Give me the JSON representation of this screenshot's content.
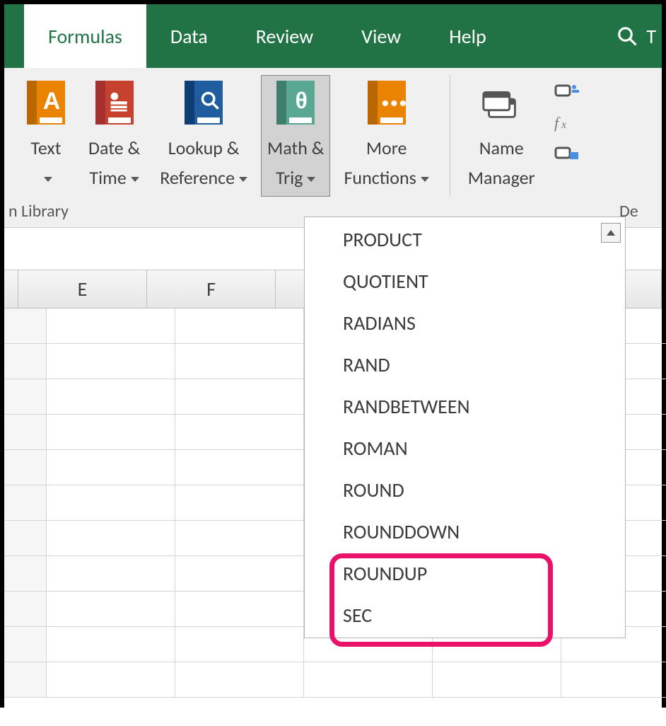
{
  "tabs": {
    "formulas": "Formulas",
    "data": "Data",
    "review": "Review",
    "view": "View",
    "help": "Help",
    "tellme": "T"
  },
  "ribbon": {
    "text": "Text",
    "datetime1": "Date &",
    "datetime2": "Time",
    "lookup1": "Lookup &",
    "lookup2": "Reference",
    "math1": "Math &",
    "math2": "Trig",
    "more1": "More",
    "more2": "Functions",
    "name1": "Name",
    "name2": "Manager",
    "group_label": "n Library",
    "de_label": "De"
  },
  "columns": {
    "E": "E",
    "F": "F"
  },
  "menu": {
    "items": [
      "PRODUCT",
      "QUOTIENT",
      "RADIANS",
      "RAND",
      "RANDBETWEEN",
      "ROMAN",
      "ROUND",
      "ROUNDDOWN",
      "ROUNDUP",
      "SEC"
    ]
  },
  "colors": {
    "excel_green": "#217346",
    "orange": "#e98300",
    "teal": "#5aa793",
    "blue": "#1f5d9e",
    "highlight": "#e9116a"
  }
}
